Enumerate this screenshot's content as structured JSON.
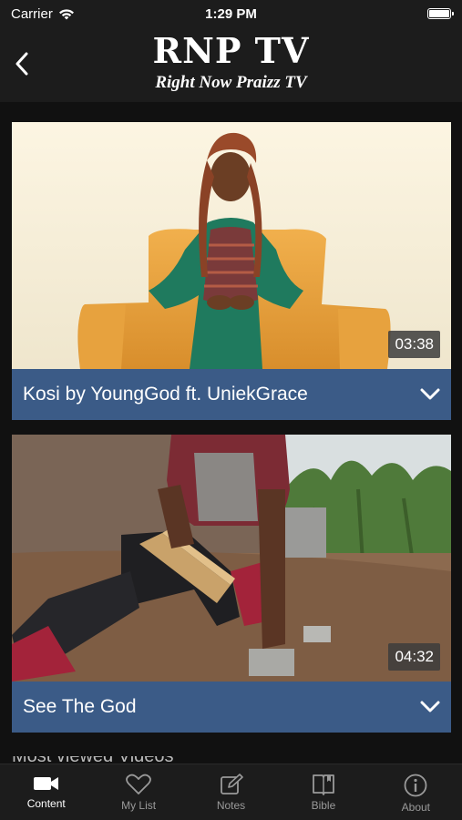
{
  "status_bar": {
    "carrier": "Carrier",
    "time": "1:29 PM"
  },
  "header": {
    "title": "RNP TV",
    "subtitle": "Right Now Praizz TV"
  },
  "videos": [
    {
      "title": "Kosi by YoungGod ft. UniekGrace",
      "duration": "03:38"
    },
    {
      "title": "See The God",
      "duration": "04:32"
    }
  ],
  "next_section_peek": "Most viewed Videos",
  "tabs": [
    {
      "label": "Content",
      "icon": "video-camera-icon",
      "active": true
    },
    {
      "label": "My List",
      "icon": "heart-icon",
      "active": false
    },
    {
      "label": "Notes",
      "icon": "pencil-square-icon",
      "active": false
    },
    {
      "label": "Bible",
      "icon": "book-icon",
      "active": false
    },
    {
      "label": "About",
      "icon": "info-circle-icon",
      "active": false
    }
  ],
  "colors": {
    "accent_bar": "#3b5b87",
    "background": "#1c1c1c"
  }
}
